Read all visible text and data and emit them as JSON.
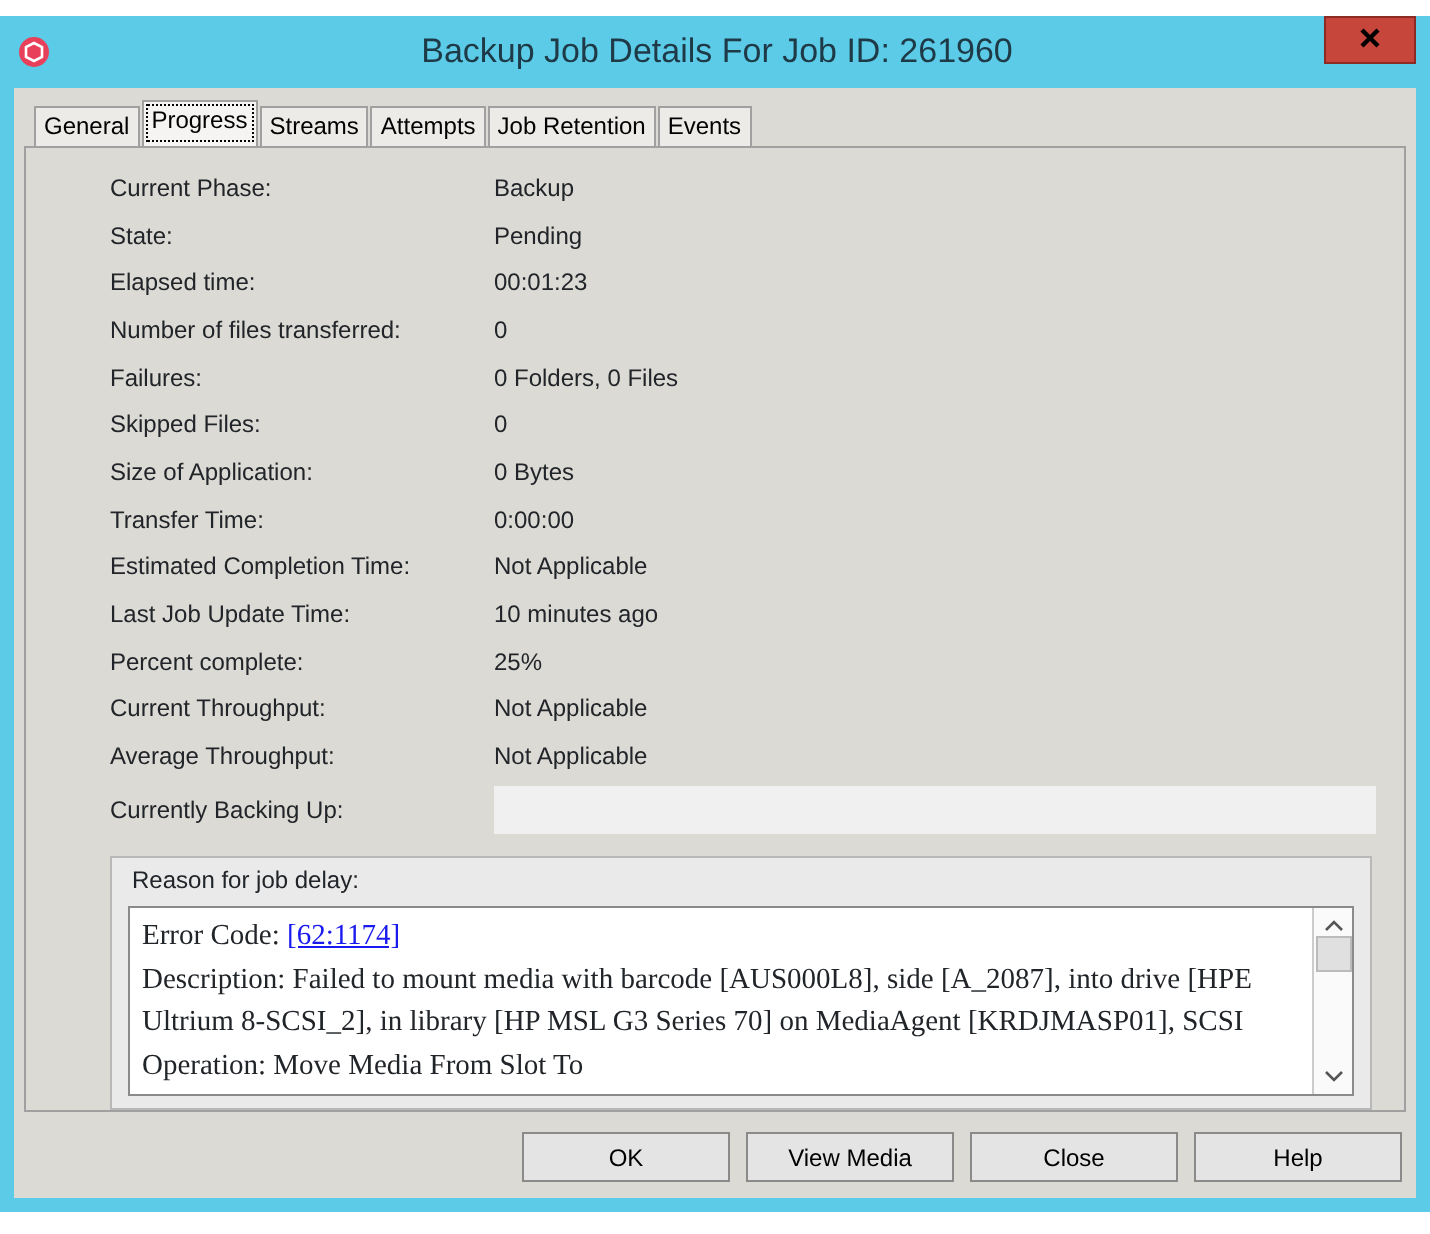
{
  "window": {
    "title": "Backup Job Details For Job ID: 261960"
  },
  "tabs": [
    {
      "label": "General",
      "selected": false
    },
    {
      "label": "Progress",
      "selected": true
    },
    {
      "label": "Streams",
      "selected": false
    },
    {
      "label": "Attempts",
      "selected": false
    },
    {
      "label": "Job Retention",
      "selected": false
    },
    {
      "label": "Events",
      "selected": false
    }
  ],
  "fields": [
    {
      "label": "Current Phase:",
      "value": "Backup"
    },
    {
      "label": "State:",
      "value": "Pending"
    },
    {
      "label": "Elapsed time:",
      "value": "00:01:23"
    },
    {
      "label": "Number of files transferred:",
      "value": "0"
    },
    {
      "label": "Failures:",
      "value": "0 Folders, 0 Files"
    },
    {
      "label": "Skipped Files:",
      "value": "0"
    },
    {
      "label": "Size of Application:",
      "value": "0 Bytes"
    },
    {
      "label": "Transfer Time:",
      "value": "0:00:00"
    },
    {
      "label": "Estimated Completion Time:",
      "value": "Not Applicable"
    },
    {
      "label": "Last Job Update Time:",
      "value": "10 minutes ago"
    },
    {
      "label": "Percent complete:",
      "value": "25%"
    },
    {
      "label": "Current Throughput:",
      "value": "Not Applicable"
    },
    {
      "label": "Average Throughput:",
      "value": "Not Applicable"
    }
  ],
  "currently_backing_up": {
    "label": "Currently Backing Up:"
  },
  "delay": {
    "title": "Reason for job delay:",
    "error_label": "Error Code:",
    "error_link": "[62:1174]",
    "description": "Description: Failed to mount media with barcode [AUS000L8], side [A_2087], into drive [HPE Ultrium 8-SCSI_2], in library [HP MSL G3 Series 70] on MediaAgent [KRDJMASP01], SCSI Operation: Move Media From Slot To"
  },
  "buttons": [
    "OK",
    "View Media",
    "Close",
    "Help"
  ]
}
